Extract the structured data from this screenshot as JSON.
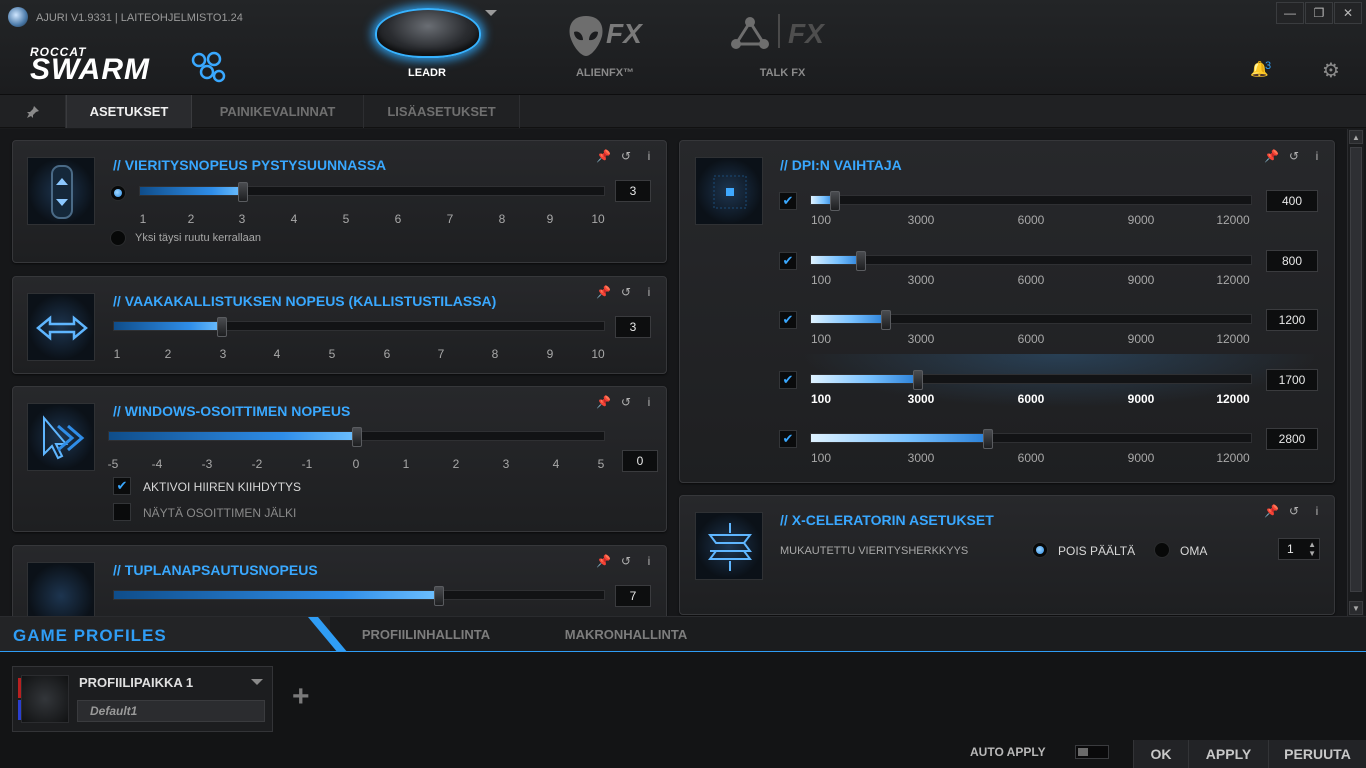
{
  "header": {
    "version": "AJURI V1.9331 | LAITEOHJELMISTO1.24",
    "logo_brand": "ROCCAT",
    "logo_name": "SWARM",
    "devices": [
      {
        "label": "LEADR",
        "active": true
      },
      {
        "label": "ALIENFX™",
        "active": false
      },
      {
        "label": "TALK FX",
        "active": false
      }
    ],
    "fx_text": "FX",
    "notification_count": "3",
    "icons": [
      "app-icon",
      "bell-icon",
      "gear-icon",
      "minimize-icon",
      "restore-icon",
      "close-icon"
    ]
  },
  "subtabs": {
    "pin": "📌",
    "items": [
      "ASETUKSET",
      "PAINIKEVALINNAT",
      "LISÄASETUKSET"
    ]
  },
  "panels": {
    "vertical_scroll": {
      "title": "VIERITYSNOPEUS PYSTYSUUNNASSA",
      "ticks": [
        "1",
        "2",
        "3",
        "4",
        "5",
        "6",
        "7",
        "8",
        "9",
        "10"
      ],
      "value": "3",
      "option_label": "Yksi täysi ruutu kerrallaan"
    },
    "tilt": {
      "title": "VAAKAKALLISTUKSEN NOPEUS (KALLISTUSTILASSA)",
      "ticks": [
        "1",
        "2",
        "3",
        "4",
        "5",
        "6",
        "7",
        "8",
        "9",
        "10"
      ],
      "value": "3"
    },
    "pointer": {
      "title": "WINDOWS-OSOITTIMEN NOPEUS",
      "ticks": [
        "-5",
        "-4",
        "-3",
        "-2",
        "-1",
        "0",
        "1",
        "2",
        "3",
        "4",
        "5"
      ],
      "value": "0",
      "accel_label": "AKTIVOI HIIREN KIIHDYTYS",
      "trail_label": "NÄYTÄ OSOITTIMEN JÄLKI"
    },
    "double_click": {
      "title": "TUPLANAPSAUTUSNOPEUS",
      "value": "7"
    },
    "dpi": {
      "title": "DPI:N VAIHTAJA",
      "ticks": [
        "100",
        "3000",
        "6000",
        "9000",
        "12000"
      ],
      "levels": [
        {
          "value": "400",
          "checked": true,
          "active": false
        },
        {
          "value": "800",
          "checked": true,
          "active": false
        },
        {
          "value": "1200",
          "checked": true,
          "active": false
        },
        {
          "value": "1700",
          "checked": true,
          "active": true
        },
        {
          "value": "2800",
          "checked": true,
          "active": false
        }
      ]
    },
    "xcelerator": {
      "title": "X-CELERATORIN ASETUKSET",
      "label": "MUKAUTETTU VIERITYSHERKKYYS",
      "off_label": "POIS PÄÄLTÄ",
      "custom_label": "OMA",
      "value": "1"
    }
  },
  "profiles": {
    "title": "GAME PROFILES",
    "tabs": [
      "PROFIILINHALLINTA",
      "MAKRONHALLINTA"
    ],
    "slot_name": "PROFIILIPAIKKA 1",
    "slot_value": "Default1",
    "add": "+"
  },
  "footer": {
    "auto_apply": "AUTO APPLY",
    "ok": "OK",
    "apply": "APPLY",
    "cancel": "PERUUTA"
  },
  "colors": {
    "accent": "#39a8ff",
    "background": "#1a1b1d"
  }
}
